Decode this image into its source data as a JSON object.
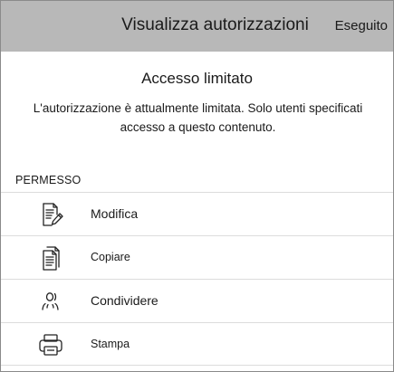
{
  "header": {
    "title": "Visualizza autorizzazioni",
    "done_label": "Eseguito"
  },
  "access": {
    "title": "Accesso limitato",
    "description": "L'autorizzazione è attualmente limitata. Solo utenti specificati accesso a questo contenuto."
  },
  "permissions": {
    "section_label": "PERMESSO",
    "items": [
      {
        "label": "Modifica",
        "icon": "edit-document-icon"
      },
      {
        "label": "Copiare",
        "icon": "copy-document-icon"
      },
      {
        "label": "Condividere",
        "icon": "share-people-icon"
      },
      {
        "label": "Stampa",
        "icon": "printer-icon"
      }
    ]
  }
}
